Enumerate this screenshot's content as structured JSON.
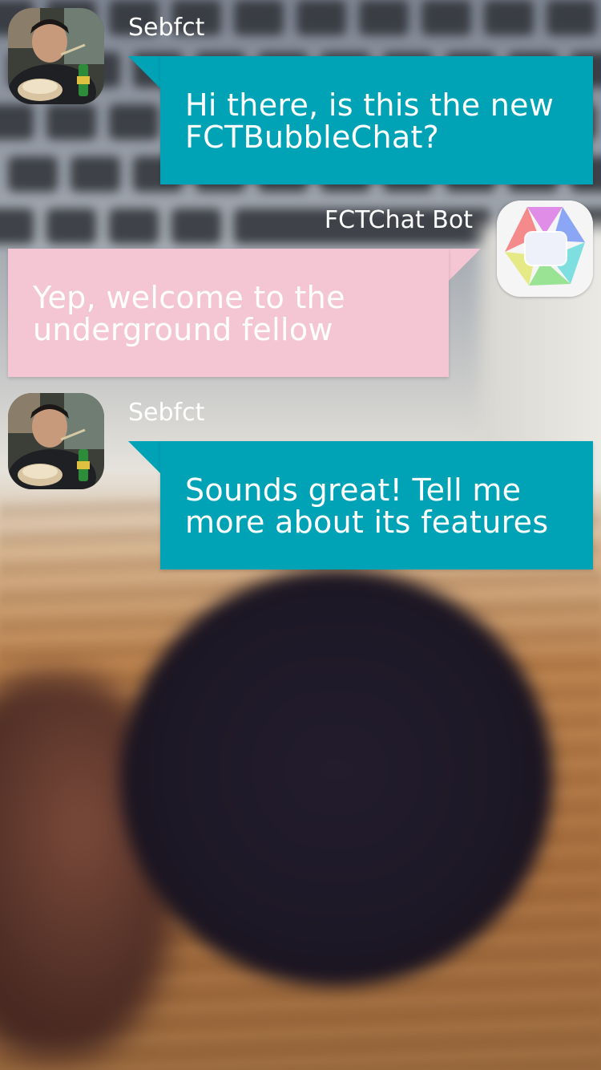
{
  "conversation": {
    "messages": [
      {
        "sender": "Sebfct",
        "text": "Hi there, is this the new\nFCTBubbleChat?",
        "direction": "outgoing",
        "avatar_icon": "user-photo-avatar"
      },
      {
        "sender": "FCTChat Bot",
        "text": "Yep, welcome to the\nunderground fellow",
        "direction": "incoming",
        "avatar_icon": "fctchat-bot-logo"
      },
      {
        "sender": "Sebfct",
        "text": "Sounds great! Tell me\nmore about its features",
        "direction": "outgoing",
        "avatar_icon": "user-photo-avatar"
      }
    ]
  },
  "colors": {
    "outgoing_bubble": "#00a2b6",
    "incoming_bubble": "#f4c6d3",
    "text": "#ffffff"
  }
}
